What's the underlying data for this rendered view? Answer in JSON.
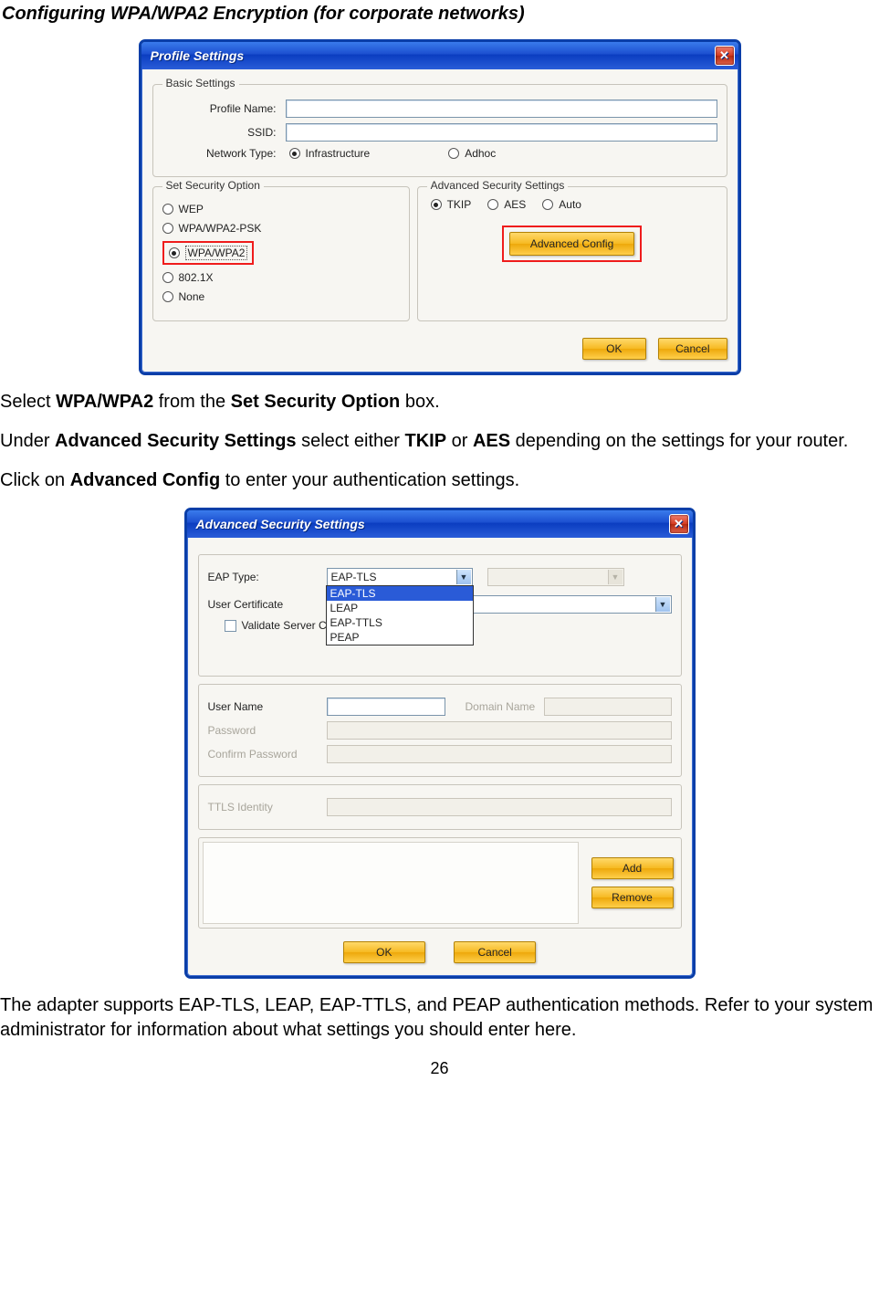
{
  "heading": "Configuring WPA/WPA2 Encryption (for corporate networks)",
  "dialog1": {
    "title": "Profile Settings",
    "close": "✕",
    "basic": {
      "legend": "Basic Settings",
      "profile_name_label": "Profile Name:",
      "profile_name_value": "",
      "ssid_label": "SSID:",
      "ssid_value": "",
      "network_type_label": "Network Type:",
      "infrastructure": "Infrastructure",
      "adhoc": "Adhoc"
    },
    "security": {
      "legend": "Set Security Option",
      "wep": "WEP",
      "wpapsk": "WPA/WPA2-PSK",
      "wpa": "WPA/WPA2",
      "dot1x": "802.1X",
      "none": "None"
    },
    "advanced": {
      "legend": "Advanced Security Settings",
      "tkip": "TKIP",
      "aes": "AES",
      "auto": "Auto",
      "advanced_config": "Advanced Config"
    },
    "ok": "OK",
    "cancel": "Cancel"
  },
  "para1_pre": "Select ",
  "para1_b1": "WPA/WPA2",
  "para1_mid": " from the ",
  "para1_b2": "Set Security Option",
  "para1_post": " box.",
  "para2_pre": "Under ",
  "para2_b1": "Advanced Security Settings",
  "para2_mid": " select either ",
  "para2_b2": "TKIP",
  "para2_mid2": " or ",
  "para2_b3": "AES",
  "para2_post": " depending on the settings for your router.",
  "para3_pre": "Click on ",
  "para3_b1": "Advanced Config",
  "para3_post": " to enter your authentication settings.",
  "dialog2": {
    "title": "Advanced Security Settings",
    "close": "✕",
    "eap_type_label": "EAP Type:",
    "eap_type_value": "EAP-TLS",
    "eap_options": [
      "EAP-TLS",
      "LEAP",
      "EAP-TTLS",
      "PEAP"
    ],
    "user_cert_label": "User Certificate",
    "validate_label": "Validate Server Cer",
    "user_name_label": "User Name",
    "domain_name_label": "Domain Name",
    "password_label": "Password",
    "confirm_password_label": "Confirm Password",
    "ttls_identity_label": "TTLS Identity",
    "add": "Add",
    "remove": "Remove",
    "ok": "OK",
    "cancel": "Cancel"
  },
  "para4": "The adapter supports EAP-TLS, LEAP, EAP-TTLS, and PEAP authentication methods. Refer to your system administrator for information about what settings you should enter here.",
  "page_number": "26"
}
